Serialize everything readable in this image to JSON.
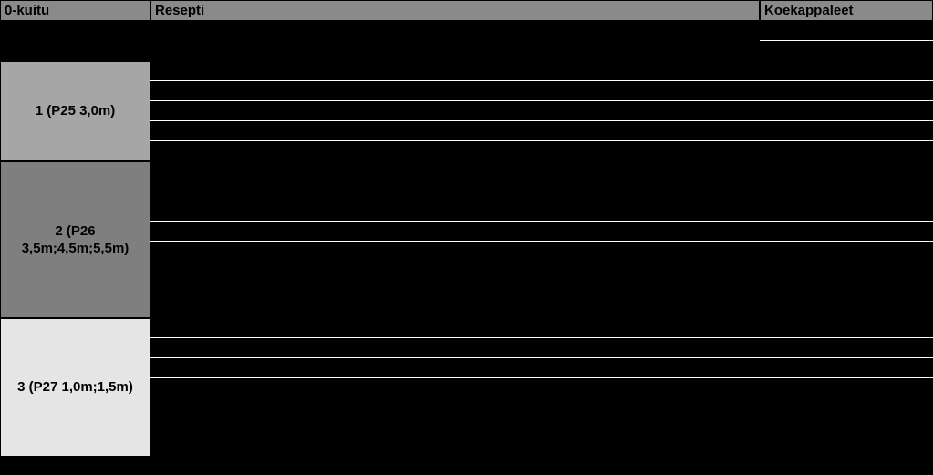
{
  "headers": {
    "col1": "0-kuitu",
    "col2": "Resepti",
    "col3": "Koekappaleet"
  },
  "groups": {
    "g1": {
      "label": "1 (P25 3,0m)"
    },
    "g2": {
      "label": "2 (P26 3,5m;4,5m;5,5m)"
    },
    "g3": {
      "label": "3 (P27 1,0m;1,5m)"
    }
  }
}
